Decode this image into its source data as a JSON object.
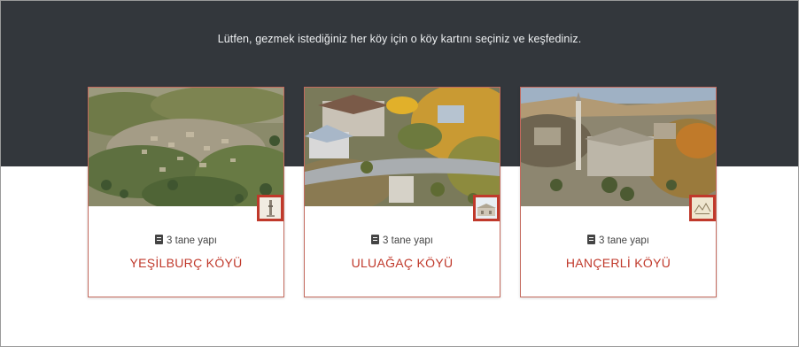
{
  "intro_text": "Lütfen, gezmek istediğiniz her köy için o köy kartını seçiniz ve keşfediniz.",
  "accent_color": "#c0392b",
  "header_color": "#33373c",
  "cards": [
    {
      "count": "3 tane yapı",
      "name": "YEŞİLBURÇ KÖYÜ",
      "icon": "building-icon"
    },
    {
      "count": "3 tane yapı",
      "name": "ULUAĞAÇ KÖYÜ",
      "icon": "building-icon"
    },
    {
      "count": "3 tane yapı",
      "name": "HANÇERLİ KÖYÜ",
      "icon": "building-icon"
    }
  ]
}
